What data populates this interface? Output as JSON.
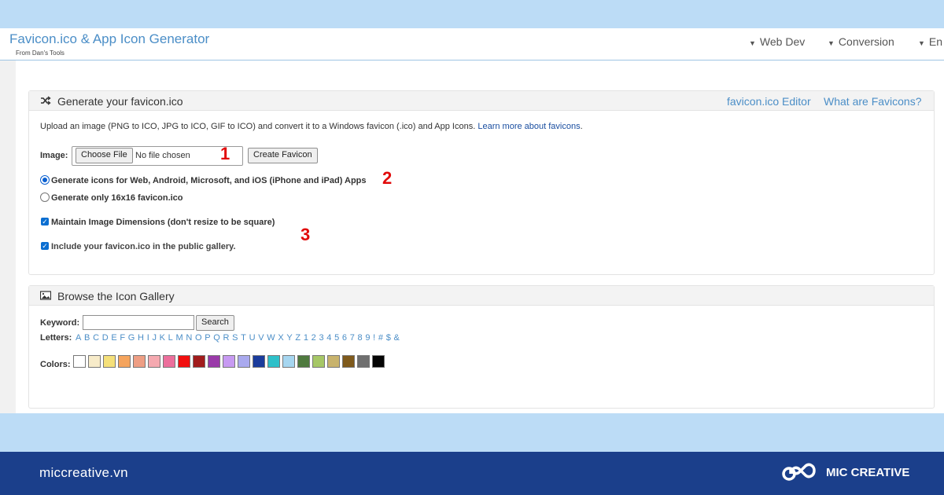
{
  "header": {
    "title": "Favicon.ico & App Icon Generator",
    "subtitle": "From Dan's Tools",
    "nav": [
      "Web Dev",
      "Conversion",
      "En"
    ]
  },
  "generator": {
    "title": "Generate your favicon.ico",
    "links": [
      "favicon.ico Editor",
      "What are Favicons?"
    ],
    "intro": "Upload an image (PNG to ICO, JPG to ICO, GIF to ICO) and convert it to a Windows favicon (.ico) and App Icons.",
    "learn_more": "Learn more about favicons",
    "image_label": "Image:",
    "choose_file": "Choose File",
    "no_file": "No file chosen",
    "create_button": "Create Favicon",
    "option_all": "Generate icons for Web, Android, Microsoft, and iOS (iPhone and iPad) Apps",
    "option_16": "Generate only 16x16 favicon.ico",
    "maintain_dims": "Maintain Image Dimensions (don't resize to be square)",
    "include_gallery": "Include your favicon.ico in the public gallery."
  },
  "callouts": [
    "1",
    "2",
    "3"
  ],
  "gallery": {
    "title": "Browse the Icon Gallery",
    "keyword_label": "Keyword:",
    "search_button": "Search",
    "letters_label": "Letters:",
    "letters": [
      "A",
      "B",
      "C",
      "D",
      "E",
      "F",
      "G",
      "H",
      "I",
      "J",
      "K",
      "L",
      "M",
      "N",
      "O",
      "P",
      "Q",
      "R",
      "S",
      "T",
      "U",
      "V",
      "W",
      "X",
      "Y",
      "Z",
      "1",
      "2",
      "3",
      "4",
      "5",
      "6",
      "7",
      "8",
      "9",
      "!",
      "#",
      "$",
      "&"
    ],
    "colors_label": "Colors:",
    "colors": [
      "#ffffff",
      "#f7ebc9",
      "#f5e07a",
      "#f5a45d",
      "#ee9e84",
      "#f5a9b0",
      "#ec6f9c",
      "#f10f0f",
      "#a11c1c",
      "#9a3aa9",
      "#c79af2",
      "#a9a9ee",
      "#1b3c9c",
      "#2ec0c9",
      "#a6d6f0",
      "#4f7a3f",
      "#a6c766",
      "#c8b36d",
      "#7f5a1c",
      "#6f6f6f",
      "#050505"
    ]
  },
  "footer": {
    "url": "miccreative.vn",
    "brand": "MIC CREATIVE"
  }
}
